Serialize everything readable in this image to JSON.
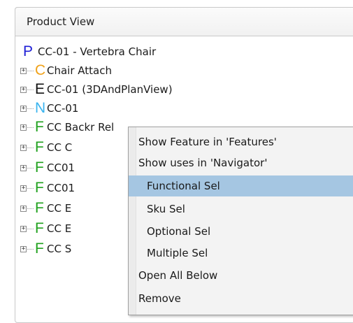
{
  "panel": {
    "title": "Product View"
  },
  "tree": {
    "root": {
      "letter": "P",
      "letter_color": "#1f1fd6",
      "label": "CC-01 - Vertebra Chair"
    },
    "nodes": [
      {
        "letter": "C",
        "letter_color": "#f0a21a",
        "label": "Chair Attach"
      },
      {
        "letter": "E",
        "letter_color": "#111111",
        "label": "CC-01 (3DAndPlanView)"
      },
      {
        "letter": "N",
        "letter_color": "#3ab4ef",
        "label": "CC-01"
      },
      {
        "letter": "F",
        "letter_color": "#20a11e",
        "label": "CC Backr Rel"
      },
      {
        "letter": "F",
        "letter_color": "#20a11e",
        "label": "CC C"
      },
      {
        "letter": "F",
        "letter_color": "#20a11e",
        "label": "CC01"
      },
      {
        "letter": "F",
        "letter_color": "#20a11e",
        "label": "CC01"
      },
      {
        "letter": "F",
        "letter_color": "#20a11e",
        "label": "CC E"
      },
      {
        "letter": "F",
        "letter_color": "#20a11e",
        "label": "CC E"
      },
      {
        "letter": "F",
        "letter_color": "#20a11e",
        "label": "CC S"
      }
    ]
  },
  "context_menu": {
    "items": [
      {
        "label": "Show Feature in 'Features'"
      },
      {
        "label": "Show uses in 'Navigator'"
      },
      {
        "label": "Functional Sel",
        "highlighted": true
      },
      {
        "label": "Sku Sel"
      },
      {
        "label": "Optional Sel"
      },
      {
        "label": "Multiple Sel"
      },
      {
        "label": "Open All Below"
      },
      {
        "label": "Remove"
      }
    ],
    "highlight_color": "#a5c6e2"
  }
}
